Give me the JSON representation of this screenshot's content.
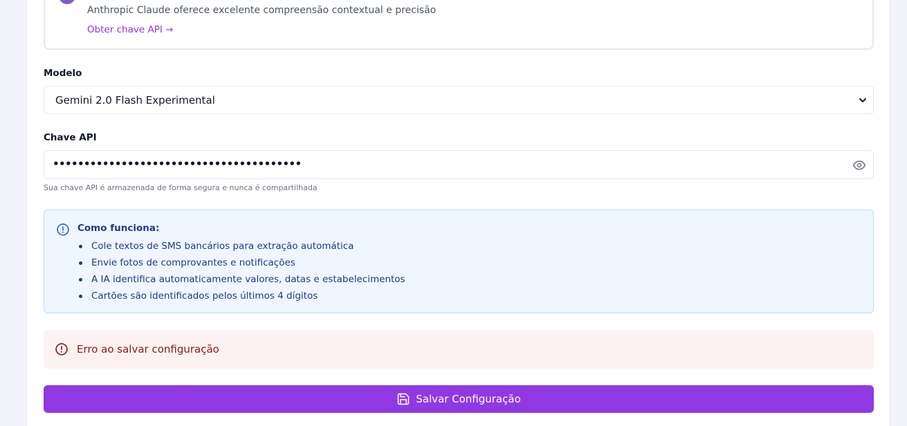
{
  "provider": {
    "description": "Anthropic Claude oferece excelente compreensão contextual e precisão",
    "link_label": "Obter chave API →"
  },
  "model": {
    "label": "Modelo",
    "selected": "Gemini 2.0 Flash Experimental"
  },
  "api_key": {
    "label": "Chave API",
    "value": "••••••••••••••••••••••••••••••••••••••••",
    "hint": "Sua chave API é armazenada de forma segura e nunca é compartilhada",
    "toggle_icon": "eye-icon"
  },
  "info": {
    "icon": "info-circle-icon",
    "title": "Como funciona:",
    "items": [
      "Cole textos de SMS bancários para extração automática",
      "Envie fotos de comprovantes e notificações",
      "A IA identifica automaticamente valores, datas e estabelecimentos",
      "Cartões são identificados pelos últimos 4 dígitos"
    ]
  },
  "error": {
    "icon": "alert-circle-icon",
    "message": "Erro ao salvar configuração"
  },
  "save": {
    "icon": "save-icon",
    "label": "Salvar Configuração"
  },
  "colors": {
    "accent": "#9039e3",
    "link": "#9333ea",
    "info_bg": "#eff6ff",
    "info_text": "#1e3a8a",
    "error_bg": "#fdf2f2",
    "error_text": "#7f1d1d"
  }
}
